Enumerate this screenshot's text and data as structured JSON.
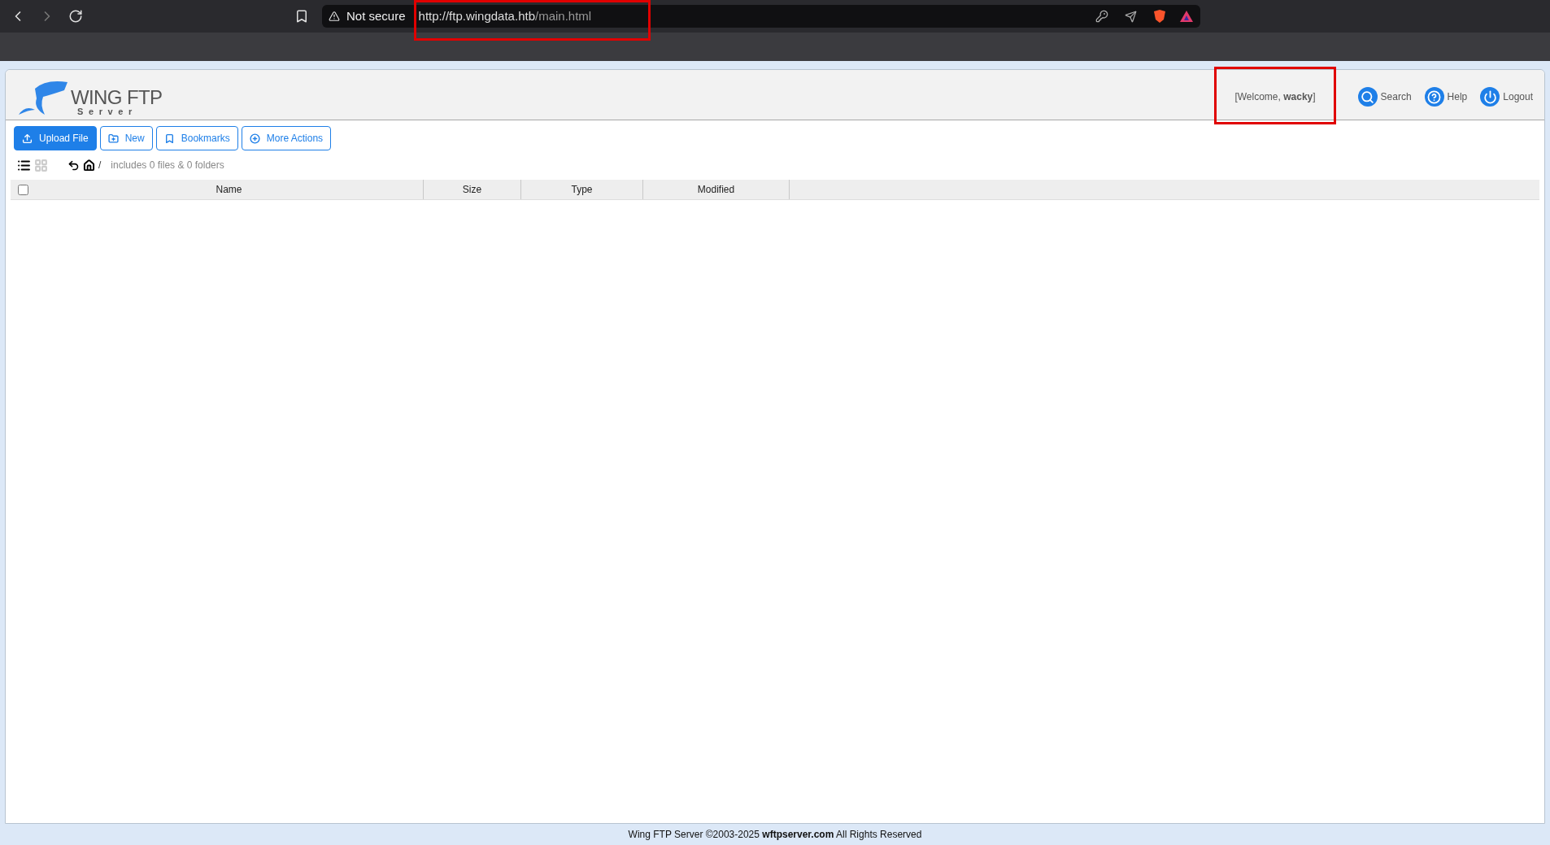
{
  "browser": {
    "security": "Not secure",
    "url_host": "http://ftp.wingdata.htb",
    "url_path": "/main.html"
  },
  "header": {
    "logo_title": "WING FTP",
    "logo_subtitle": "Server",
    "welcome": "[Welcome, **wacky**]",
    "links": [
      {
        "kind": "search",
        "label": "Search"
      },
      {
        "kind": "help",
        "label": "Help"
      },
      {
        "kind": "logout",
        "label": "Logout"
      }
    ]
  },
  "toolbar": [
    {
      "kind": "upload",
      "label": "Upload File",
      "primary": true
    },
    {
      "kind": "new",
      "label": "New",
      "primary": false
    },
    {
      "kind": "bookmarks",
      "label": "Bookmarks",
      "primary": false
    },
    {
      "kind": "more",
      "label": "More Actions",
      "primary": false
    }
  ],
  "path": {
    "views": [
      {
        "kind": "list",
        "selected": true
      },
      {
        "kind": "grid",
        "selected": false
      }
    ],
    "location": "/",
    "summary": "includes 0 files & 0 folders"
  },
  "table": {
    "all_checked": false,
    "columns": [
      "Name",
      "Size",
      "Type",
      "Modified"
    ]
  },
  "footer": {
    "before": "Wing FTP Server ©2003-2025",
    "link": "wftpserver.com",
    "after": "All Rights Reserved"
  }
}
